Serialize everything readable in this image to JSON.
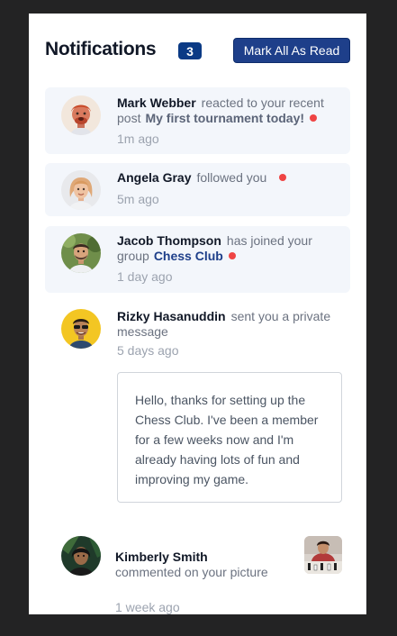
{
  "header": {
    "title": "Notifications",
    "unread_count": "3",
    "mark_all_label": "Mark All As Read"
  },
  "notifications": [
    {
      "user": "Mark Webber",
      "action": "reacted to your recent post",
      "target": "My first tournament today!",
      "time": "1m ago",
      "unread": true
    },
    {
      "user": "Angela Gray",
      "action": "followed you",
      "time": "5m ago",
      "unread": true
    },
    {
      "user": "Jacob Thompson",
      "action": "has joined your group",
      "target": "Chess Club",
      "time": "1 day ago",
      "unread": true
    },
    {
      "user": "Rizky Hasanuddin",
      "action": "sent you a private message",
      "time": "5 days ago",
      "unread": false,
      "message": "Hello, thanks for setting up the Chess Club. I've been a member for a few weeks now and I'm already having lots of fun and improving my game."
    },
    {
      "user": "Kimberly Smith",
      "action": "commented on your picture",
      "time": "1 week ago",
      "unread": false
    }
  ],
  "colors": {
    "page_bg": "#232324",
    "card_bg": "#ffffff",
    "unread_bg": "#f3f6fb",
    "accent": "#1e3f8a",
    "badge": "#0b3a85",
    "unread_dot": "#ef4444"
  },
  "icons": {
    "unread_indicator": "unread-dot-icon"
  }
}
